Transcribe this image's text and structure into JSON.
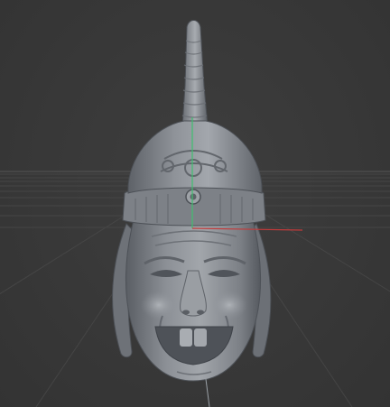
{
  "viewport": {
    "background_color": "#393939",
    "grid_color": "#4a4a4a",
    "horizon_color": "#555555",
    "model_base_color": "#8c9096",
    "model_shadow_color": "#5d6167",
    "model_highlight_color": "#b6babf"
  },
  "gizmo": {
    "y_axis_color": "#3fbf6f",
    "x_axis_color": "#c43a3a",
    "z_axis_color": "#9aa0a6"
  },
  "model": {
    "icon": "sculpted-head-mesh-icon"
  }
}
